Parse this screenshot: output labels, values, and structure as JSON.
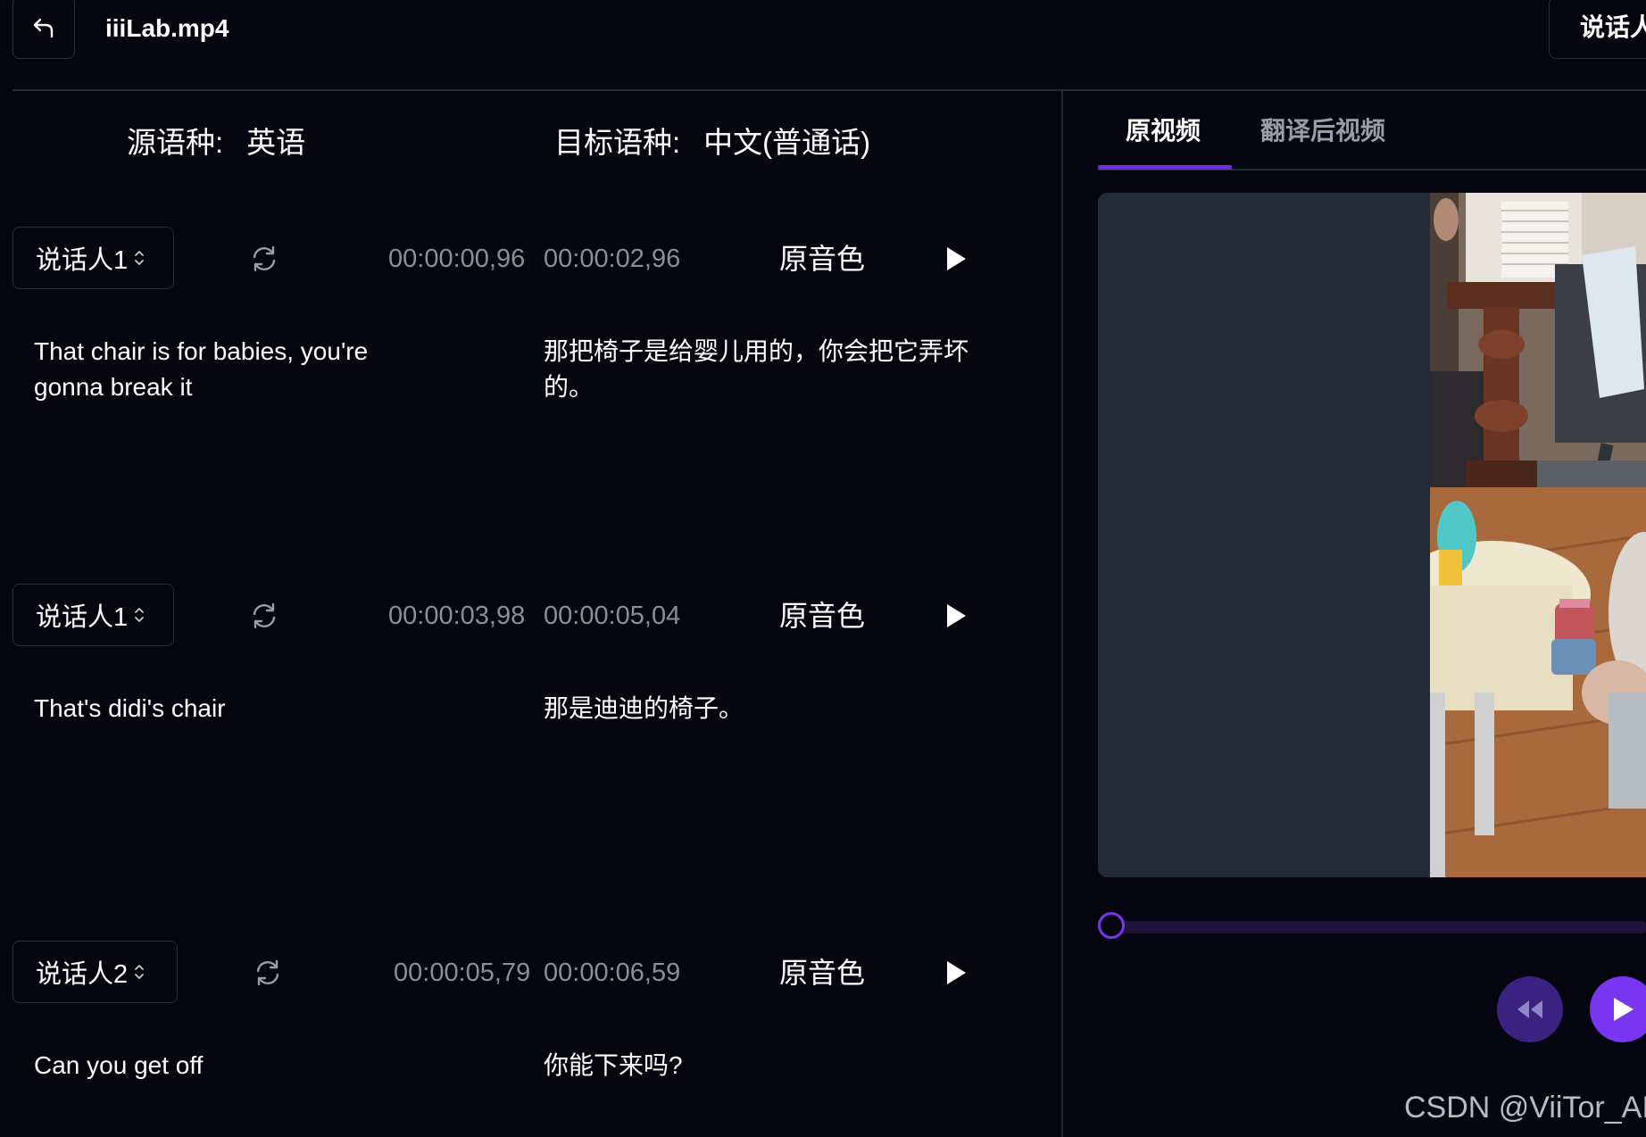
{
  "header": {
    "file_name": "iiiLab.mp4",
    "right_button_label": "说话人"
  },
  "languages": {
    "source_label": "源语种:",
    "source_value": "英语",
    "target_label": "目标语种:",
    "target_value": "中文(普通话)"
  },
  "segments": [
    {
      "speaker": "说话人1",
      "start": "00:00:00,96",
      "end": "00:00:02,96",
      "voice": "原音色",
      "source_text": "That chair is for babies, you're gonna break it",
      "target_text": "那把椅子是给婴儿用的，你会把它弄坏的。"
    },
    {
      "speaker": "说话人1",
      "start": "00:00:03,98",
      "end": "00:00:05,04",
      "voice": "原音色",
      "source_text": "That's didi's chair",
      "target_text": "那是迪迪的椅子。"
    },
    {
      "speaker": "说话人2",
      "start": "00:00:05,79",
      "end": "00:00:06,59",
      "voice": "原音色",
      "source_text": "Can you get off",
      "target_text": "你能下来吗?"
    }
  ],
  "video_panel": {
    "tabs": [
      {
        "label": "原视频",
        "active": true
      },
      {
        "label": "翻译后视频",
        "active": false
      }
    ],
    "progress": 0
  },
  "watermark": "CSDN @ViiTor_AI",
  "icons": {
    "back": "back-arrow-icon",
    "refresh": "refresh-icon",
    "play": "play-icon",
    "rewind": "rewind-icon",
    "chevron": "up-down-chevron-icon"
  },
  "colors": {
    "background": "#04050f",
    "accent": "#7a35f0",
    "accent_dark": "#3a2280",
    "muted_text": "#8b8e98",
    "video_bg": "#232936"
  }
}
